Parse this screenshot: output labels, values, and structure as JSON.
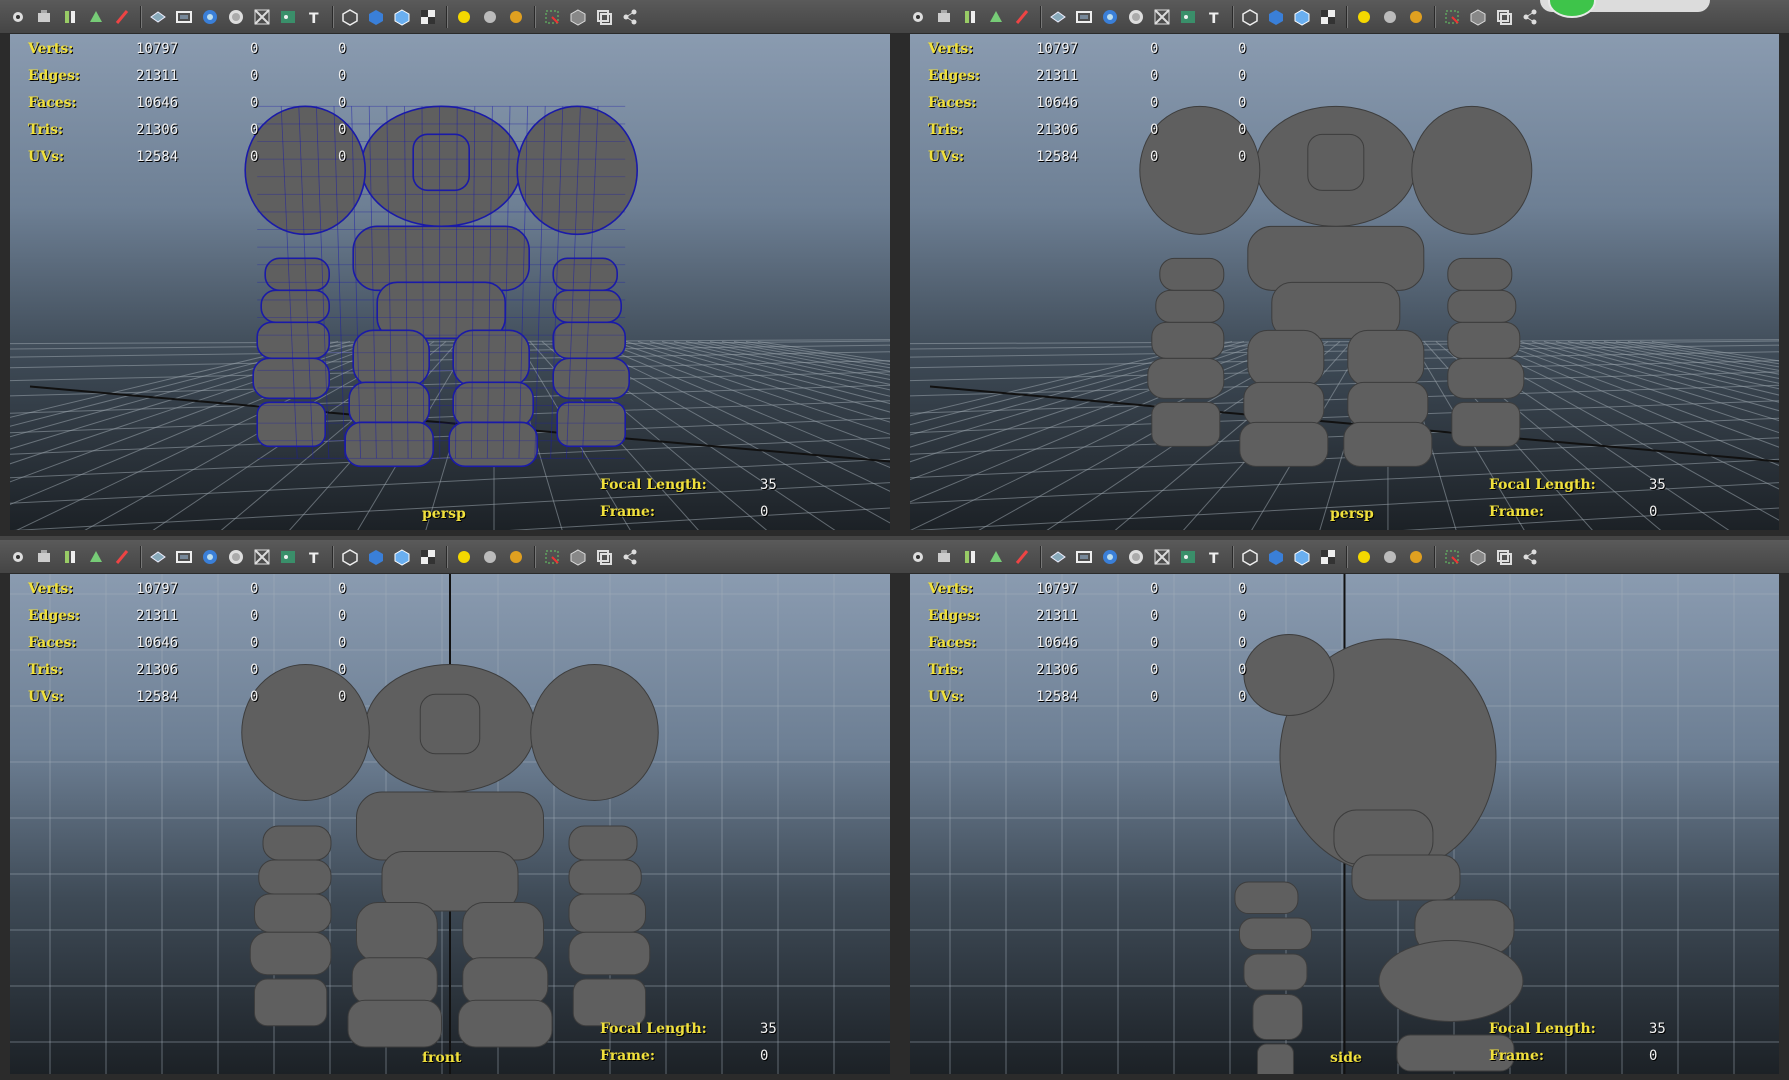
{
  "stats": {
    "rows": [
      {
        "label": "Verts:",
        "value": "10797",
        "sel": "0",
        "tri": "0"
      },
      {
        "label": "Edges:",
        "value": "21311",
        "sel": "0",
        "tri": "0"
      },
      {
        "label": "Faces:",
        "value": "10646",
        "sel": "0",
        "tri": "0"
      },
      {
        "label": "Tris:",
        "value": "21306",
        "sel": "0",
        "tri": "0"
      },
      {
        "label": "UVs:",
        "value": "12584",
        "sel": "0",
        "tri": "0"
      }
    ]
  },
  "camera_info": {
    "focal_label": "Focal Length:",
    "focal_value": "35",
    "frame_label": "Frame:",
    "frame_value": "0"
  },
  "panels": [
    {
      "camera": "persp",
      "mode": "wireframe-on-shaded"
    },
    {
      "camera": "persp",
      "mode": "shaded"
    },
    {
      "camera": "front",
      "mode": "shaded"
    },
    {
      "camera": "side",
      "mode": "shaded"
    }
  ],
  "toolbar_icons": [
    "camera-select-icon",
    "camera-attributes-icon",
    "bookmark-icon",
    "image-plane-icon",
    "grease-pencil-icon",
    "grid-icon",
    "film-gate-icon",
    "resolution-gate-icon",
    "gate-mask-icon",
    "field-chart-icon",
    "safe-action-icon",
    "safe-title-icon",
    "wireframe-icon",
    "smooth-shade-icon",
    "wireframe-on-shaded-icon",
    "textured-icon",
    "use-all-lights-icon",
    "shadows-icon",
    "high-quality-icon",
    "isolate-select-icon",
    "xray-icon",
    "xray-joints-icon",
    "xray-components-icon"
  ],
  "colors": {
    "hud_label": "#f0e03c",
    "hud_value": "#f2f2f2",
    "wireframe": "#1a1aa8",
    "mesh": "#5f5f5f"
  }
}
